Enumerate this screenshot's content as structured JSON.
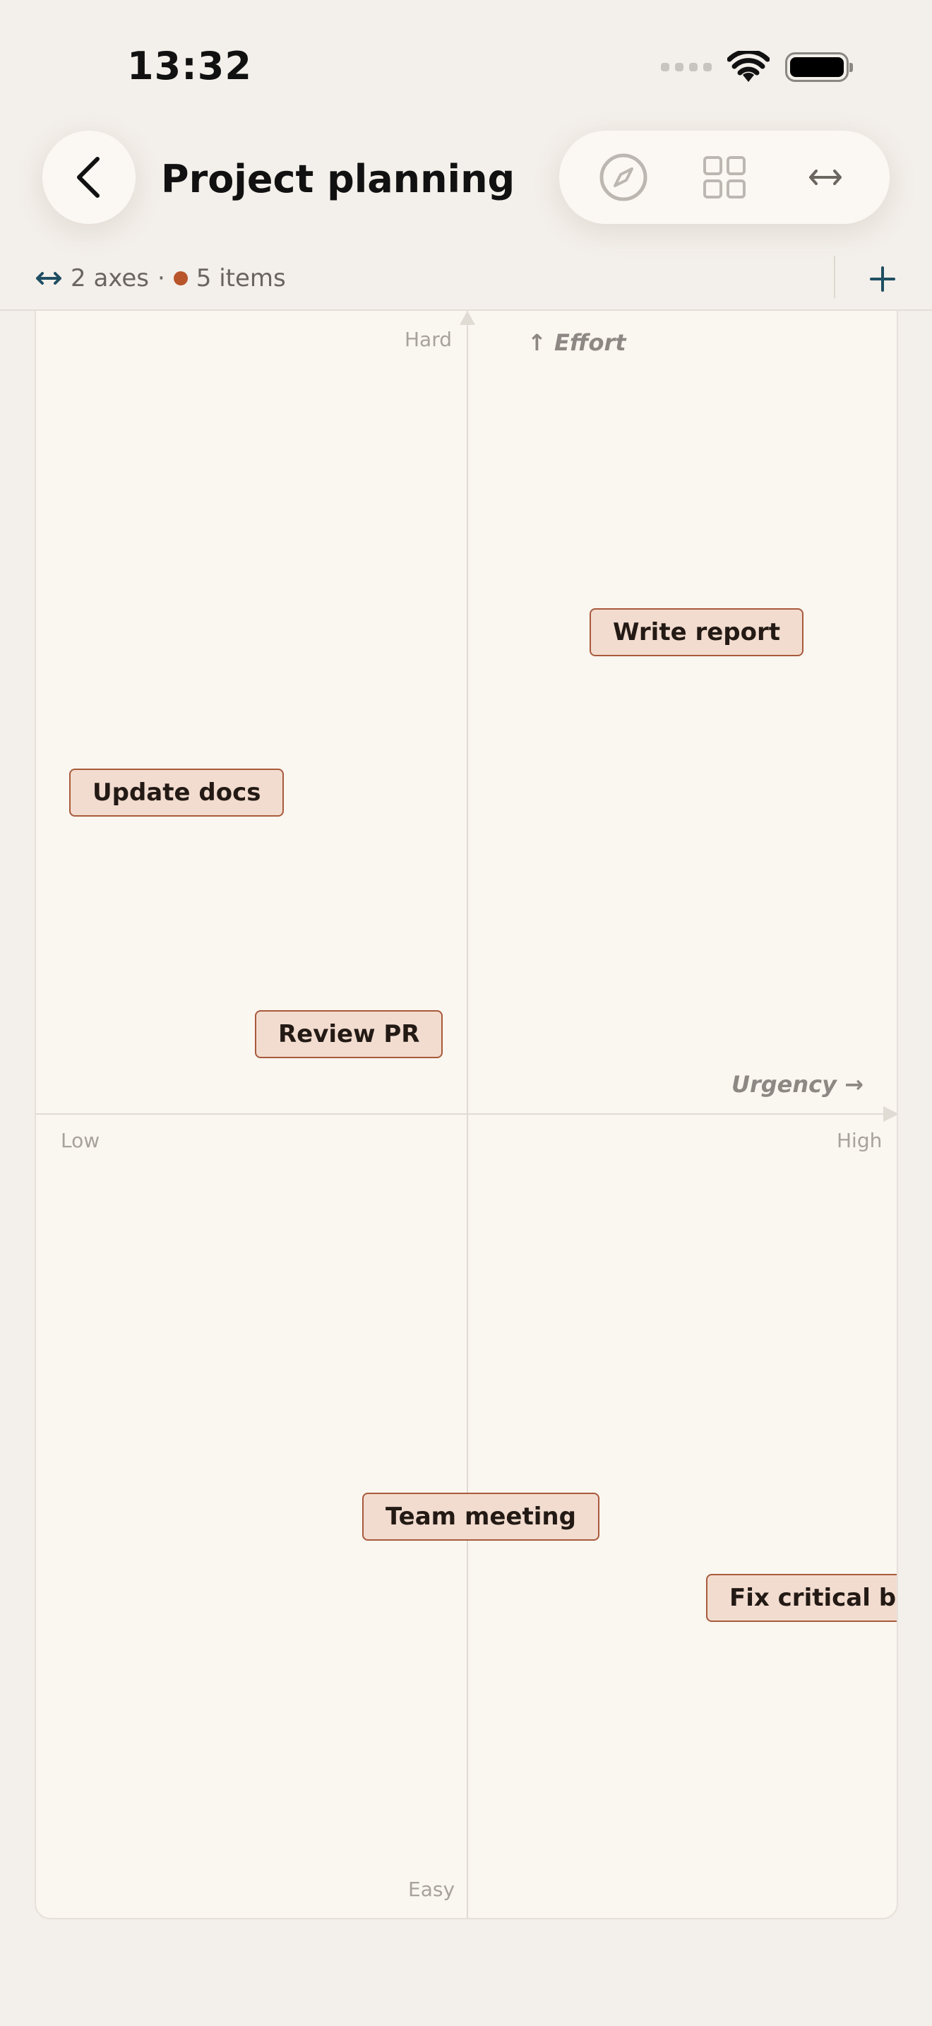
{
  "status": {
    "time": "13:32"
  },
  "nav": {
    "title": "Project planning"
  },
  "info": {
    "axes": "2 axes",
    "separator": "·",
    "items": "5 items"
  },
  "canvas": {
    "y_axis": {
      "title": "↑ Effort",
      "top_label": "Hard",
      "bottom_label": "Easy"
    },
    "x_axis": {
      "title": "Urgency →",
      "left_label": "Low",
      "right_label": "High"
    },
    "items": [
      {
        "label": "Write report"
      },
      {
        "label": "Update docs"
      },
      {
        "label": "Review PR"
      },
      {
        "label": "Team meeting"
      },
      {
        "label": "Fix critical bug"
      }
    ]
  },
  "colors": {
    "accent": "#b8552a",
    "chip_fill": "#f2dccf",
    "chip_border": "#a85a3c",
    "icon_blue": "#1f4e63"
  }
}
